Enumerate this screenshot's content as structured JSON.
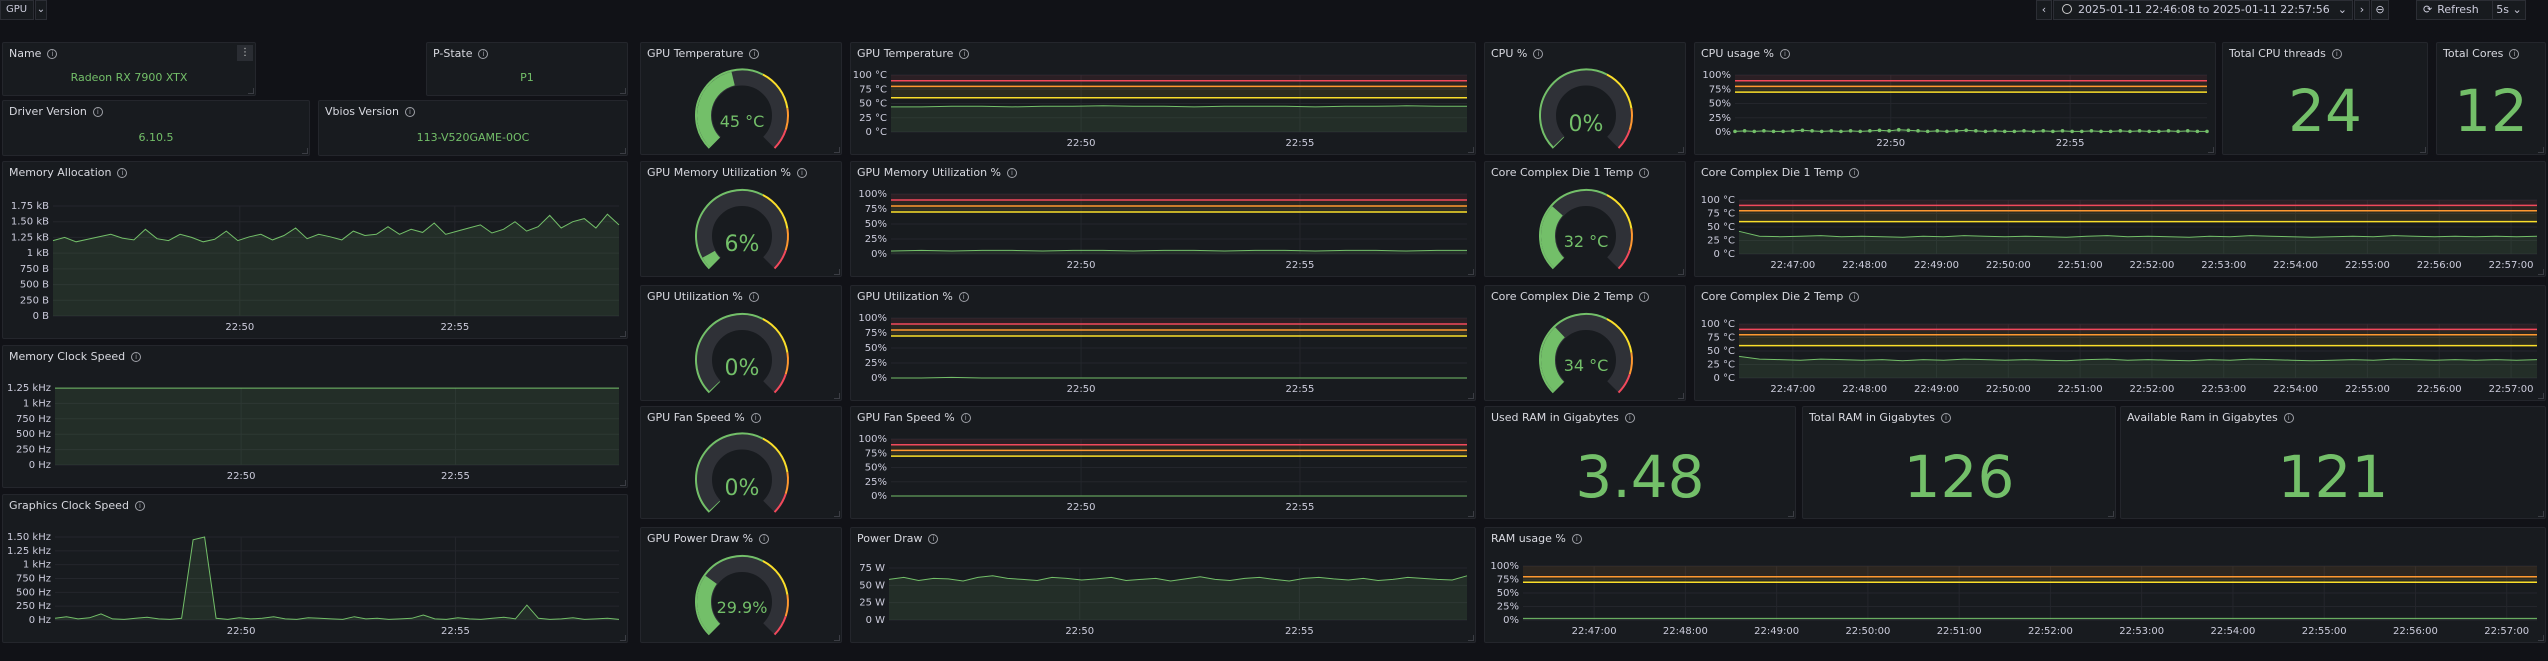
{
  "topbar": {
    "variable_label": "GPU",
    "variable_chevron": "chevron-down-icon",
    "prev_label": "‹",
    "next_label": "›",
    "time_range": "2025-01-11 22:46:08 to 2025-01-11 22:57:56",
    "refresh_label": "Refresh",
    "interval": "5s"
  },
  "stats": {
    "name": {
      "title": "Name",
      "value": "Radeon RX 7900 XTX"
    },
    "pstate": {
      "title": "P-State",
      "value": "P1"
    },
    "driver": {
      "title": "Driver Version",
      "value": "6.10.5"
    },
    "vbios": {
      "title": "Vbios Version",
      "value": "113-V520GAME-0OC"
    },
    "cpu_threads": {
      "title": "Total CPU threads",
      "value": "24"
    },
    "cores": {
      "title": "Total Cores",
      "value": "12"
    },
    "used_ram": {
      "title": "Used RAM in Gigabytes",
      "value": "3.48"
    },
    "total_ram": {
      "title": "Total RAM in Gigabytes",
      "value": "126"
    },
    "avail_ram": {
      "title": "Available Ram in Gigabytes",
      "value": "121"
    }
  },
  "gauges": {
    "gpu_temp": {
      "title": "GPU Temperature",
      "value": "45 °C",
      "fraction": 0.45
    },
    "gpu_mem_util": {
      "title": "GPU Memory Utilization %",
      "value": "6%",
      "fraction": 0.06
    },
    "gpu_util": {
      "title": "GPU Utilization %",
      "value": "0%",
      "fraction": 0.0
    },
    "gpu_fan": {
      "title": "GPU Fan Speed %",
      "value": "0%",
      "fraction": 0.0
    },
    "gpu_power": {
      "title": "GPU Power Draw %",
      "value": "29.9%",
      "fraction": 0.299
    },
    "cpu_pct": {
      "title": "CPU %",
      "value": "0%",
      "fraction": 0.0
    },
    "ccd1": {
      "title": "Core Complex Die 1 Temp",
      "value": "32 °C",
      "fraction": 0.32
    },
    "ccd2": {
      "title": "Core Complex Die 2 Temp",
      "value": "34 °C",
      "fraction": 0.34
    }
  },
  "colors": {
    "green": "#73bf69",
    "yellow": "#fade2a",
    "orange": "#ff9830",
    "red": "#f2495c",
    "panel": "#181b1f",
    "bg": "#111217"
  },
  "chart_data": [
    {
      "id": "mem_alloc",
      "title": "Memory Allocation",
      "type": "line",
      "yticks": [
        "1.75 kB",
        "1.50 kB",
        "1.25 kB",
        "1 kB",
        "750 B",
        "500 B",
        "250 B",
        "0 B"
      ],
      "xticks": [
        "22:50",
        "22:55"
      ],
      "ylim": [
        0,
        1750
      ],
      "y": [
        1200,
        1250,
        1180,
        1220,
        1260,
        1300,
        1240,
        1210,
        1380,
        1230,
        1200,
        1300,
        1250,
        1180,
        1220,
        1350,
        1200,
        1260,
        1300,
        1210,
        1280,
        1400,
        1230,
        1300,
        1260,
        1210,
        1350,
        1280,
        1300,
        1420,
        1300,
        1380,
        1330,
        1480,
        1300,
        1350,
        1400,
        1450,
        1320,
        1380,
        1500,
        1350,
        1420,
        1600,
        1400,
        1500,
        1550,
        1400,
        1620,
        1450
      ]
    },
    {
      "id": "mem_clock",
      "title": "Memory Clock Speed",
      "type": "line",
      "yticks": [
        "1.25 kHz",
        "1 kHz",
        "750 Hz",
        "500 Hz",
        "250 Hz",
        "0 Hz"
      ],
      "xticks": [
        "22:50",
        "22:55"
      ],
      "ylim": [
        0,
        1250
      ],
      "y": [
        1249,
        1249,
        1249,
        1249,
        1249,
        1249,
        1249,
        1249,
        1249,
        1249
      ]
    },
    {
      "id": "gfx_clock",
      "title": "Graphics Clock Speed",
      "type": "line",
      "yticks": [
        "1.50 kHz",
        "1.25 kHz",
        "1 kHz",
        "750 Hz",
        "500 Hz",
        "250 Hz",
        "0 Hz"
      ],
      "xticks": [
        "22:50",
        "22:55"
      ],
      "ylim": [
        0,
        1500
      ],
      "y": [
        30,
        60,
        20,
        40,
        110,
        20,
        10,
        30,
        50,
        20,
        10,
        30,
        1450,
        1500,
        30,
        10,
        40,
        20,
        30,
        60,
        20,
        10,
        40,
        30,
        20,
        10,
        60,
        20,
        30,
        10,
        20,
        30,
        90,
        20,
        10,
        40,
        20,
        10,
        30,
        50,
        20,
        270,
        30,
        10,
        20,
        40,
        10,
        20,
        30,
        10
      ]
    },
    {
      "id": "gpu_temp_ts",
      "title": "GPU Temperature",
      "type": "line",
      "yticks": [
        "100 °C",
        "75 °C",
        "50 °C",
        "25 °C",
        "0 °C"
      ],
      "xticks": [
        "22:50",
        "22:55"
      ],
      "ylim": [
        0,
        100
      ],
      "thresholds": [
        60,
        80,
        90
      ],
      "y": [
        44,
        44,
        45,
        45,
        44,
        45,
        45,
        46,
        45,
        45,
        44,
        45,
        45,
        45,
        44,
        45,
        45,
        46,
        45,
        45
      ]
    },
    {
      "id": "gpu_mem_ts",
      "title": "GPU Memory Utilization %",
      "type": "line",
      "yticks": [
        "100%",
        "75%",
        "50%",
        "25%",
        "0%"
      ],
      "xticks": [
        "22:50",
        "22:55"
      ],
      "ylim": [
        0,
        100
      ],
      "thresholds": [
        70,
        80,
        90
      ],
      "y": [
        5,
        6,
        5,
        6,
        6,
        5,
        6,
        6,
        5,
        6,
        6,
        5,
        6,
        6,
        5,
        6,
        6,
        5,
        6,
        6
      ]
    },
    {
      "id": "gpu_util_ts",
      "title": "GPU Utilization %",
      "type": "line",
      "yticks": [
        "100%",
        "75%",
        "50%",
        "25%",
        "0%"
      ],
      "xticks": [
        "22:50",
        "22:55"
      ],
      "ylim": [
        0,
        100
      ],
      "thresholds": [
        70,
        80,
        90
      ],
      "y": [
        0,
        0,
        1,
        0,
        0,
        0,
        0,
        0,
        0,
        0,
        0,
        0,
        0,
        0,
        0,
        0,
        0,
        0,
        0,
        0
      ]
    },
    {
      "id": "gpu_fan_ts",
      "title": "GPU Fan Speed %",
      "type": "line",
      "yticks": [
        "100%",
        "75%",
        "50%",
        "25%",
        "0%"
      ],
      "xticks": [
        "22:50",
        "22:55"
      ],
      "ylim": [
        0,
        100
      ],
      "thresholds": [
        70,
        80,
        90
      ],
      "y": [
        0,
        0,
        0,
        0,
        0,
        0,
        0,
        0,
        0,
        0,
        0,
        0,
        0,
        0,
        0,
        0,
        0,
        0,
        0,
        0
      ]
    },
    {
      "id": "power_ts",
      "title": "Power Draw",
      "type": "line",
      "yticks": [
        "75 W",
        "50 W",
        "25 W",
        "0 W"
      ],
      "xticks": [
        "22:50",
        "22:55"
      ],
      "ylim": [
        0,
        100
      ],
      "y": [
        78,
        82,
        76,
        80,
        79,
        75,
        82,
        85,
        80,
        78,
        76,
        82,
        80,
        77,
        79,
        82,
        76,
        78,
        80,
        75,
        79,
        83,
        78,
        76,
        80,
        82,
        78,
        75,
        80,
        82,
        79,
        77,
        80,
        76,
        78,
        82,
        80,
        78,
        77,
        85
      ]
    },
    {
      "id": "cpu_usage_ts",
      "title": "CPU usage %",
      "type": "line",
      "yticks": [
        "100%",
        "75%",
        "50%",
        "25%",
        "0%"
      ],
      "xticks": [
        "22:50",
        "22:55"
      ],
      "ylim": [
        0,
        100
      ],
      "thresholds": [
        70,
        80,
        90
      ],
      "points": true,
      "y": [
        1,
        2,
        1,
        2,
        1,
        1,
        2,
        3,
        2,
        1,
        2,
        1,
        2,
        1,
        2,
        3,
        2,
        4,
        3,
        2,
        1,
        2,
        1,
        2,
        3,
        2,
        1,
        2,
        1,
        1,
        2,
        1,
        2,
        1,
        2,
        1,
        1,
        2,
        1,
        1,
        2,
        1,
        2,
        1,
        1,
        2,
        1,
        2,
        1,
        1
      ]
    },
    {
      "id": "ccd1_ts",
      "title": "Core Complex Die 1 Temp",
      "type": "line",
      "yticks": [
        "100 °C",
        "75 °C",
        "50 °C",
        "25 °C",
        "0 °C"
      ],
      "xticks": [
        "22:47:00",
        "22:48:00",
        "22:49:00",
        "22:50:00",
        "22:51:00",
        "22:52:00",
        "22:53:00",
        "22:54:00",
        "22:55:00",
        "22:56:00",
        "22:57:00"
      ],
      "ylim": [
        0,
        100
      ],
      "thresholds": [
        60,
        80,
        90
      ],
      "y": [
        42,
        33,
        32,
        33,
        34,
        32,
        33,
        32,
        31,
        33,
        32,
        34,
        33,
        32,
        33,
        32,
        31,
        33,
        34,
        32,
        33,
        32,
        31,
        33,
        32,
        34,
        33,
        32,
        31,
        32,
        33,
        32,
        34,
        33,
        32,
        33,
        32,
        33,
        32,
        33
      ]
    },
    {
      "id": "ccd2_ts",
      "title": "Core Complex Die 2 Temp",
      "type": "line",
      "yticks": [
        "100 °C",
        "75 °C",
        "50 °C",
        "25 °C",
        "0 °C"
      ],
      "xticks": [
        "22:47:00",
        "22:48:00",
        "22:49:00",
        "22:50:00",
        "22:51:00",
        "22:52:00",
        "22:53:00",
        "22:54:00",
        "22:55:00",
        "22:56:00",
        "22:57:00"
      ],
      "ylim": [
        0,
        100
      ],
      "thresholds": [
        60,
        80,
        90
      ],
      "y": [
        40,
        35,
        34,
        33,
        35,
        34,
        33,
        34,
        32,
        34,
        33,
        35,
        34,
        33,
        34,
        33,
        32,
        34,
        35,
        33,
        34,
        33,
        32,
        34,
        33,
        35,
        34,
        33,
        32,
        33,
        34,
        33,
        35,
        34,
        33,
        34,
        33,
        34,
        33,
        34
      ]
    },
    {
      "id": "ram_usage_ts",
      "title": "RAM usage %",
      "type": "line",
      "yticks": [
        "100%",
        "75%",
        "50%",
        "25%",
        "0%"
      ],
      "xticks": [
        "22:47:00",
        "22:48:00",
        "22:49:00",
        "22:50:00",
        "22:51:00",
        "22:52:00",
        "22:53:00",
        "22:54:00",
        "22:55:00",
        "22:56:00",
        "22:57:00"
      ],
      "ylim": [
        0,
        100
      ],
      "thresholds": [
        70,
        80
      ],
      "y": [
        3,
        3,
        3,
        3,
        3,
        3,
        3,
        3,
        3,
        3,
        3,
        3,
        3,
        3,
        3,
        3,
        3,
        3,
        3,
        3
      ]
    }
  ]
}
